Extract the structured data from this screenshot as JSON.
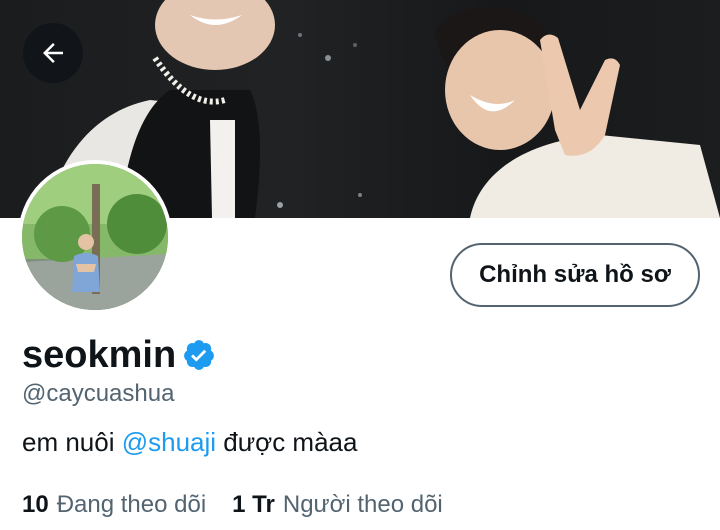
{
  "header": {
    "back_icon": "arrow-left-icon"
  },
  "profile": {
    "display_name": "seokmin",
    "verified_icon": "verified-badge-icon",
    "handle": "@caycuashua",
    "bio_prefix": "em nuôi ",
    "bio_mention": "@shuaji",
    "bio_suffix": " được màaa",
    "edit_button_label": "Chỉnh sửa hồ sơ"
  },
  "stats": {
    "following_count": "10",
    "following_label": "Đang theo dõi",
    "followers_count": "1 Tr",
    "followers_label": "Người theo dõi"
  },
  "colors": {
    "accent": "#1d9bf0",
    "secondary_text": "#536471",
    "primary_text": "#0f1419"
  }
}
